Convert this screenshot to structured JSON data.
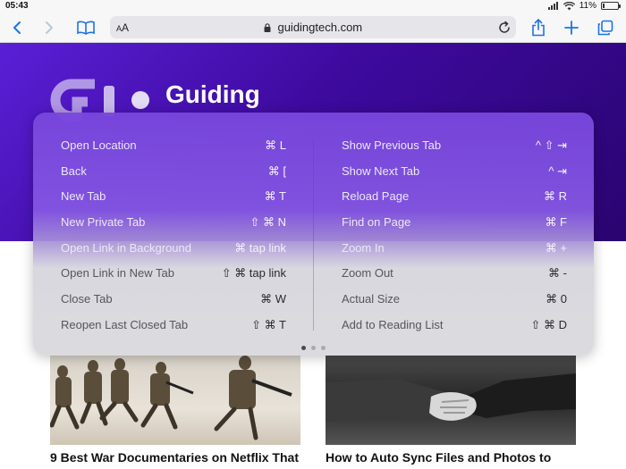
{
  "status": {
    "time": "05:43",
    "battery": "11%",
    "battery_level": 0.11
  },
  "toolbar": {
    "text_size_label_small": "A",
    "text_size_label_large": "A",
    "url": "guidingtech.com"
  },
  "page": {
    "brand": "Guiding",
    "articles": [
      {
        "title": "9 Best War Documentaries on Netflix That"
      },
      {
        "title": "How to Auto Sync Files and Photos to"
      }
    ]
  },
  "shortcuts": {
    "left": [
      {
        "label": "Open Location",
        "keys": "⌘  L"
      },
      {
        "label": "Back",
        "keys": "⌘  ["
      },
      {
        "label": "New Tab",
        "keys": "⌘  T"
      },
      {
        "label": "New Private Tab",
        "keys": "⇧  ⌘  N"
      },
      {
        "label": "Open Link in Background",
        "keys": "⌘  tap link"
      },
      {
        "label": "Open Link in New Tab",
        "keys": "⇧  ⌘  tap link"
      },
      {
        "label": "Close Tab",
        "keys": "⌘  W"
      },
      {
        "label": "Reopen Last Closed Tab",
        "keys": "⇧  ⌘  T"
      }
    ],
    "right": [
      {
        "label": "Show Previous Tab",
        "keys": "^  ⇧  ⇥"
      },
      {
        "label": "Show Next Tab",
        "keys": "^  ⇥"
      },
      {
        "label": "Reload Page",
        "keys": "⌘  R"
      },
      {
        "label": "Find on Page",
        "keys": "⌘  F"
      },
      {
        "label": "Zoom In",
        "keys": "⌘  +"
      },
      {
        "label": "Zoom Out",
        "keys": "⌘  -"
      },
      {
        "label": "Actual Size",
        "keys": "⌘  0"
      },
      {
        "label": "Add to Reading List",
        "keys": "⇧  ⌘  D"
      }
    ],
    "pages": 3,
    "current_page": 1
  },
  "colors": {
    "accent": "#1a73e8",
    "hero": "#3d0a9e"
  }
}
